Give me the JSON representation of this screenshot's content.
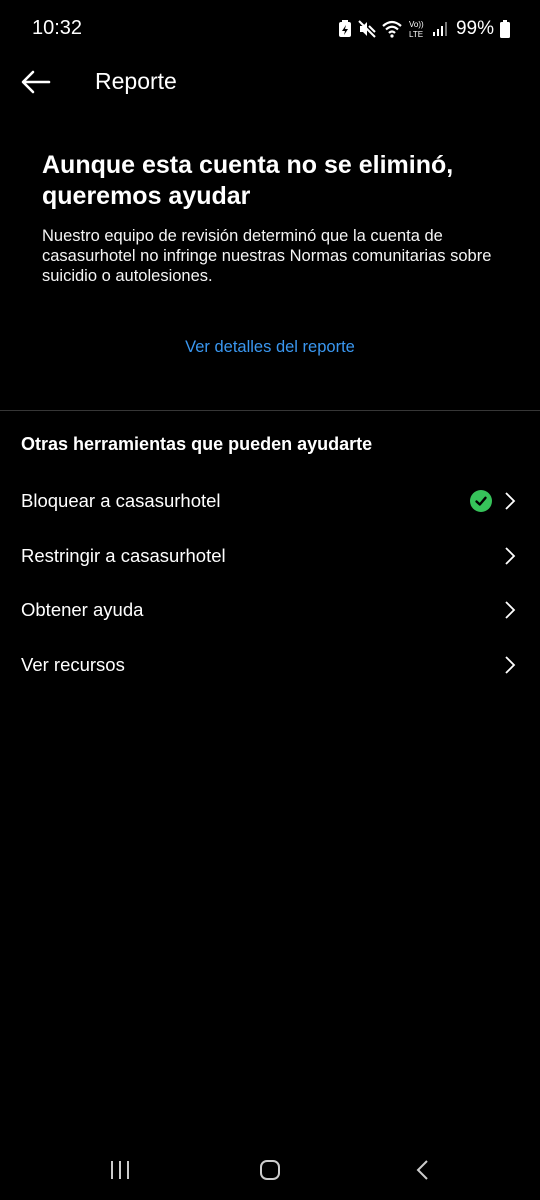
{
  "status_bar": {
    "time": "10:32",
    "battery": "99%",
    "icons": [
      "battery-saver-icon",
      "mute-icon",
      "wifi-icon",
      "volte-icon",
      "signal-icon",
      "battery-icon"
    ]
  },
  "app_bar": {
    "title": "Reporte",
    "back_icon": "arrow-left-icon"
  },
  "report": {
    "headline_line1": "Aunque esta cuenta no se eliminó,",
    "headline_line2": "queremos ayudar",
    "description_line1": "Nuestro equipo de revisión determinó que la cuenta de",
    "description_line2": "casasurhotel no infringe nuestras Normas comunitarias sobre",
    "description_line3": "suicidio o autolesiones.",
    "details_link": "Ver detalles del reporte"
  },
  "tools": {
    "title": "Otras herramientas que pueden ayudarte",
    "items": [
      {
        "label": "Bloquear a casasurhotel",
        "checked": true
      },
      {
        "label": "Restringir a casasurhotel",
        "checked": false
      },
      {
        "label": "Obtener ayuda",
        "checked": false
      },
      {
        "label": "Ver recursos",
        "checked": false
      }
    ]
  },
  "colors": {
    "background": "#000000",
    "link": "#3a97f0",
    "check": "#36c35a",
    "divider": "#363636"
  },
  "nav_bar": {
    "icons": [
      "recent-apps-icon",
      "home-icon",
      "back-nav-icon"
    ]
  }
}
